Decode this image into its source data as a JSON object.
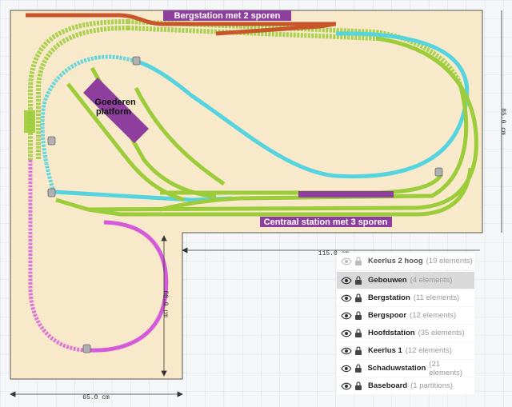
{
  "labels": {
    "mountain_station": "Bergstation met 2 sporen",
    "central_station": "Centraal station met 3 sporen",
    "freight_platform_line1": "Goederen",
    "freight_platform_line2": "platform"
  },
  "dimensions": {
    "width_top": "115.0 cm",
    "width_bottom": "65.0 cm",
    "height_right": "85.0 cm",
    "height_left": "60.0 cm"
  },
  "colors": {
    "baseboard": "#f7e9c9",
    "track_green": "#9ccc3a",
    "track_cyan": "#55d4e0",
    "track_magenta": "#d35ad8",
    "track_red": "#c8542a",
    "building_purple": "#8e3f9e"
  },
  "layers": [
    {
      "name": "Keerlus 2 hoog",
      "count": "(19 elements)",
      "visible": false,
      "selected": false
    },
    {
      "name": "Gebouwen",
      "count": "(4 elements)",
      "visible": true,
      "selected": true
    },
    {
      "name": "Bergstation",
      "count": "(11 elements)",
      "visible": true,
      "selected": false
    },
    {
      "name": "Bergspoor",
      "count": "(12 elements)",
      "visible": true,
      "selected": false
    },
    {
      "name": "Hoofdstation",
      "count": "(35 elements)",
      "visible": true,
      "selected": false
    },
    {
      "name": "Keerlus 1",
      "count": "(12 elements)",
      "visible": true,
      "selected": false
    },
    {
      "name": "Schaduwstation",
      "count": "(21 elements)",
      "visible": true,
      "selected": false
    },
    {
      "name": "Baseboard",
      "count": "(1 partitions)",
      "visible": true,
      "selected": false
    }
  ]
}
